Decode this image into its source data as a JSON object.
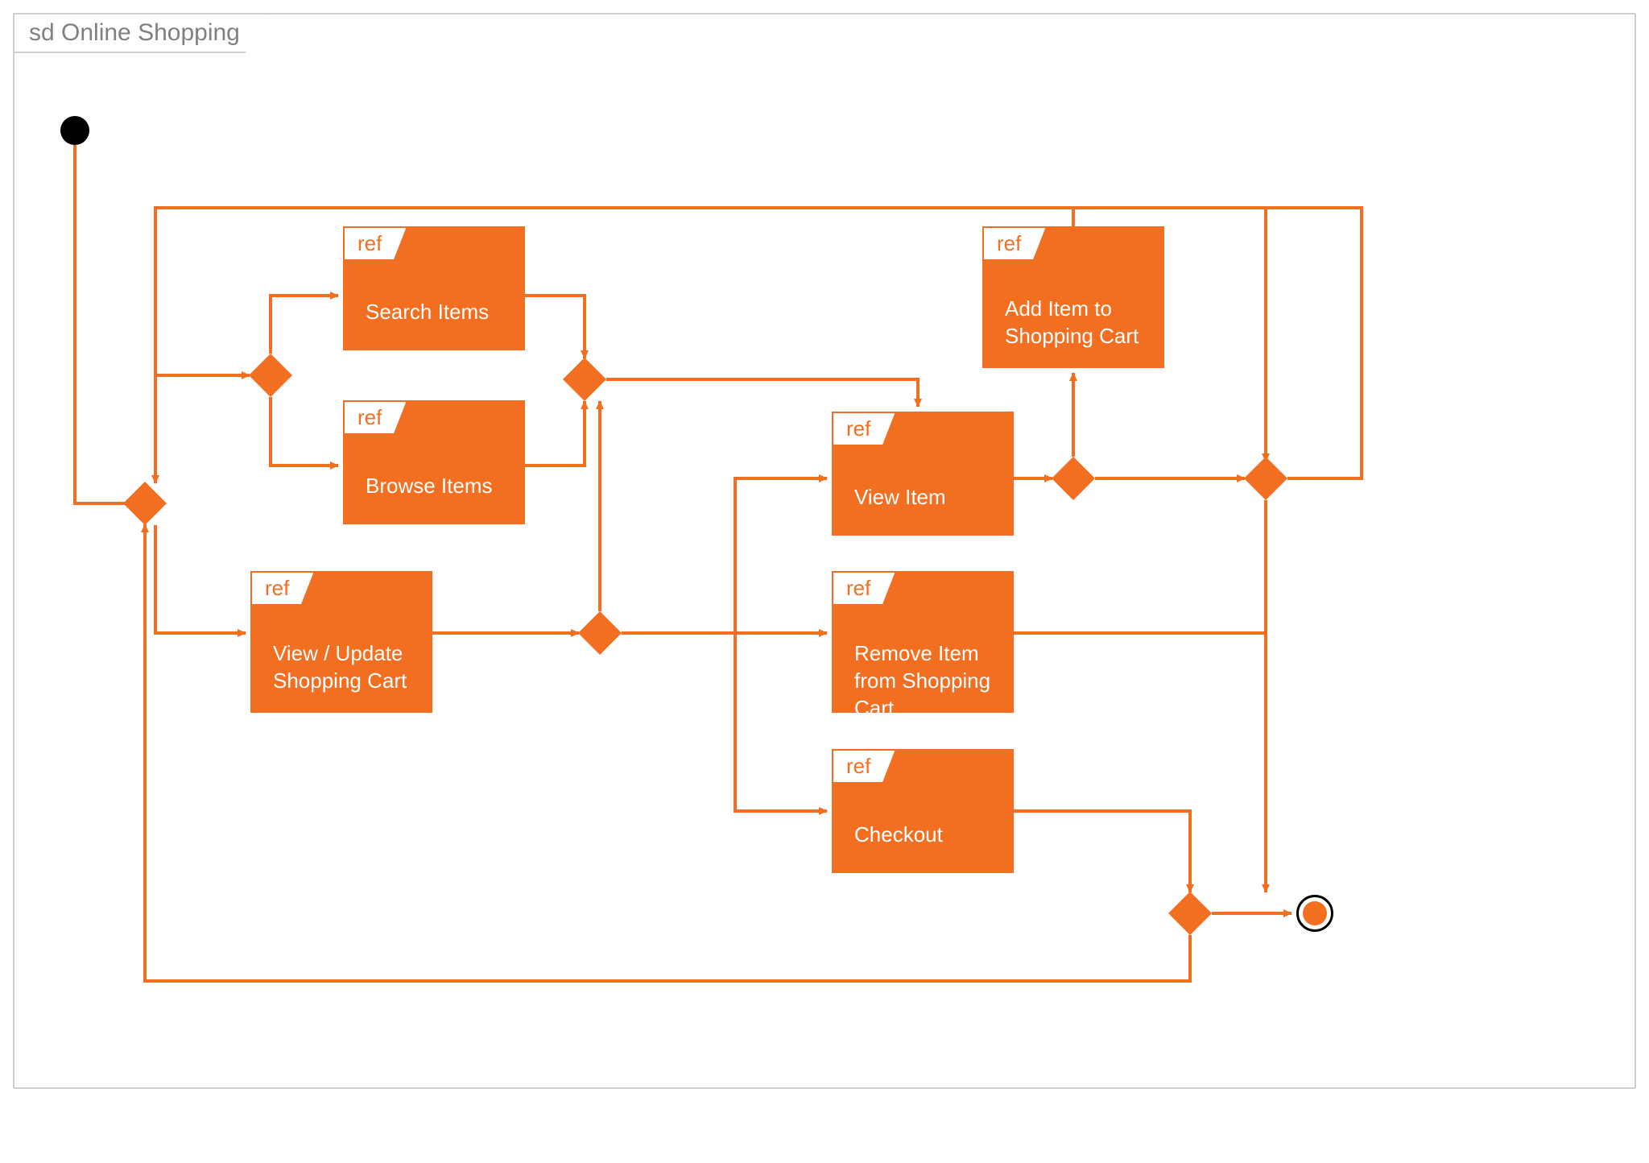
{
  "diagram": {
    "frame_title": "sd Online Shopping",
    "ref_tag": "ref",
    "nodes": {
      "search_items": "Search Items",
      "browse_items": "Browse Items",
      "view_update_cart": "View / Update Shopping Cart",
      "view_item": "View Item",
      "add_item": "Add Item to Shopping Cart",
      "remove_item": "Remove Item from Shopping Cart",
      "checkout": "Checkout"
    },
    "colors": {
      "accent": "#f26f21",
      "frame_border": "#cfcfcf",
      "frame_text": "#808080",
      "start": "#000000"
    }
  }
}
